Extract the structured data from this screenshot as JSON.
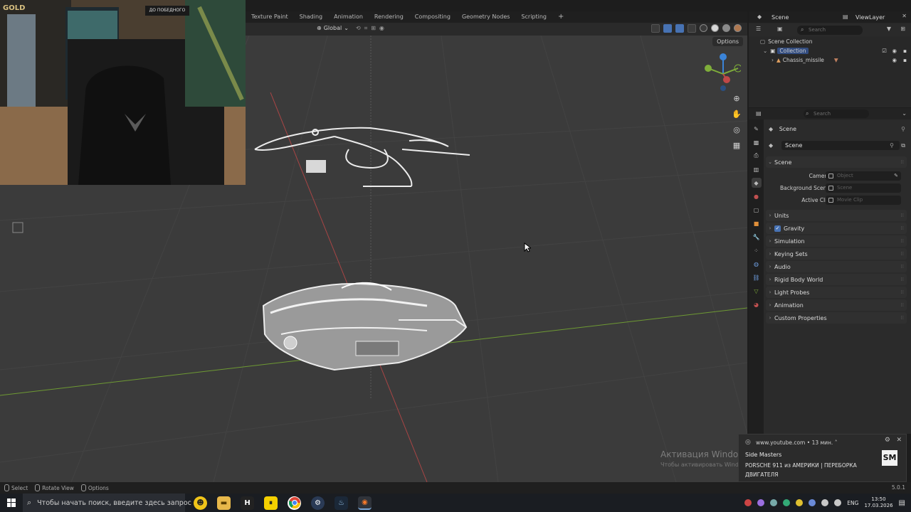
{
  "workspace_tabs": [
    "Texture Paint",
    "Shading",
    "Animation",
    "Rendering",
    "Compositing",
    "Geometry Nodes",
    "Scripting",
    "+"
  ],
  "viewport": {
    "orientation": "Global",
    "options_label": "Options",
    "gizmo_axes": [
      "Z",
      "Y",
      "X"
    ]
  },
  "watermark": {
    "line1": "Активация Windows",
    "line2": "Чтобы активировать Windows, перейдите в раздел \"Параметры\"."
  },
  "webcam": {
    "sign_gold": "GOLD",
    "sign_text": "ДО ПОБЕДНОГО"
  },
  "outliner": {
    "scene": "Scene",
    "view_layer": "ViewLayer",
    "search_placeholder": "Search",
    "rows": [
      {
        "label": "Scene Collection",
        "indent": 0
      },
      {
        "label": "Collection",
        "indent": 1
      },
      {
        "label": "Chassis_missile",
        "indent": 2
      }
    ]
  },
  "properties": {
    "search_placeholder": "Search",
    "context": "Scene",
    "scene_field": "Scene",
    "panel_scene": "Scene",
    "camera_label": "Camera",
    "camera_placeholder": "Object",
    "bg_scene_label": "Background Scene",
    "bg_scene_placeholder": "Scene",
    "active_clip_label": "Active Clip",
    "active_clip_placeholder": "Movie Clip",
    "panels": [
      "Units",
      "Gravity",
      "Simulation",
      "Keying Sets",
      "Audio",
      "Rigid Body World",
      "Light Probes",
      "Animation",
      "Custom Properties"
    ],
    "gravity_checked": true
  },
  "notification": {
    "source": "www.youtube.com",
    "time": "13 мин.",
    "title": "Side Masters",
    "body": "PORSCHE 911 из АМЕРИКИ | ПЕРЕБОРКА ДВИГАТЕЛЯ",
    "logo": "SM"
  },
  "statusbar": {
    "select": "Select",
    "rotate": "Rotate View",
    "options": "Options",
    "version": "5.0.1"
  },
  "taskbar": {
    "search_placeholder": "Чтобы начать поиск, введите здесь запрос",
    "lang": "ENG",
    "time": "13:50",
    "date": "17.03.2026",
    "apps": [
      "emoji",
      "explorer",
      "h-app",
      "norton",
      "chrome",
      "steam-tool",
      "steam",
      "blender"
    ]
  },
  "colors": {
    "accent": "#4772b3",
    "x_axis": "#c04848",
    "y_axis": "#7fae3a",
    "z_axis": "#3b84d8",
    "viewport_bg": "#3b3b3b"
  }
}
